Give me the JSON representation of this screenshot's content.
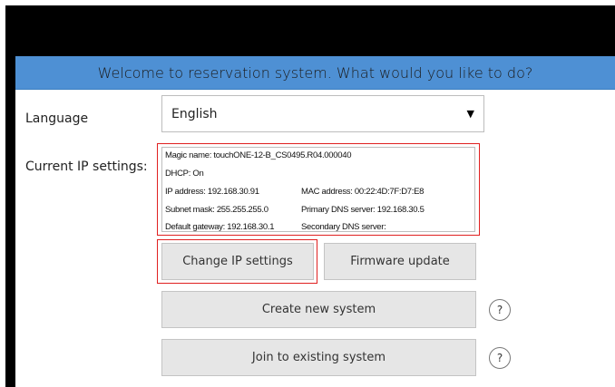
{
  "header": {
    "title": "Welcome to reservation system. What would you like to do?"
  },
  "language": {
    "label": "Language",
    "selected": "English"
  },
  "ip_settings": {
    "label": "Current IP settings:",
    "magic_name": "Magic name: touchONE-12-B_CS0495.R04.000040",
    "dhcp": "DHCP: On",
    "ip_address": "IP address: 192.168.30.91",
    "mac_address": "MAC address: 00:22:4D:7F:D7:E8",
    "subnet_mask": "Subnet mask: 255.255.255.0",
    "primary_dns": "Primary DNS server: 192.168.30.5",
    "default_gateway": "Default gateway: 192.168.30.1",
    "secondary_dns": "Secondary DNS server:"
  },
  "buttons": {
    "change_ip": "Change IP settings",
    "firmware_update": "Firmware update",
    "create_system": "Create new system",
    "join_system": "Join to existing system",
    "help": "?"
  },
  "colors": {
    "header_bg": "#4e90d4",
    "highlight": "#e02020",
    "button_bg": "#e6e6e6"
  }
}
